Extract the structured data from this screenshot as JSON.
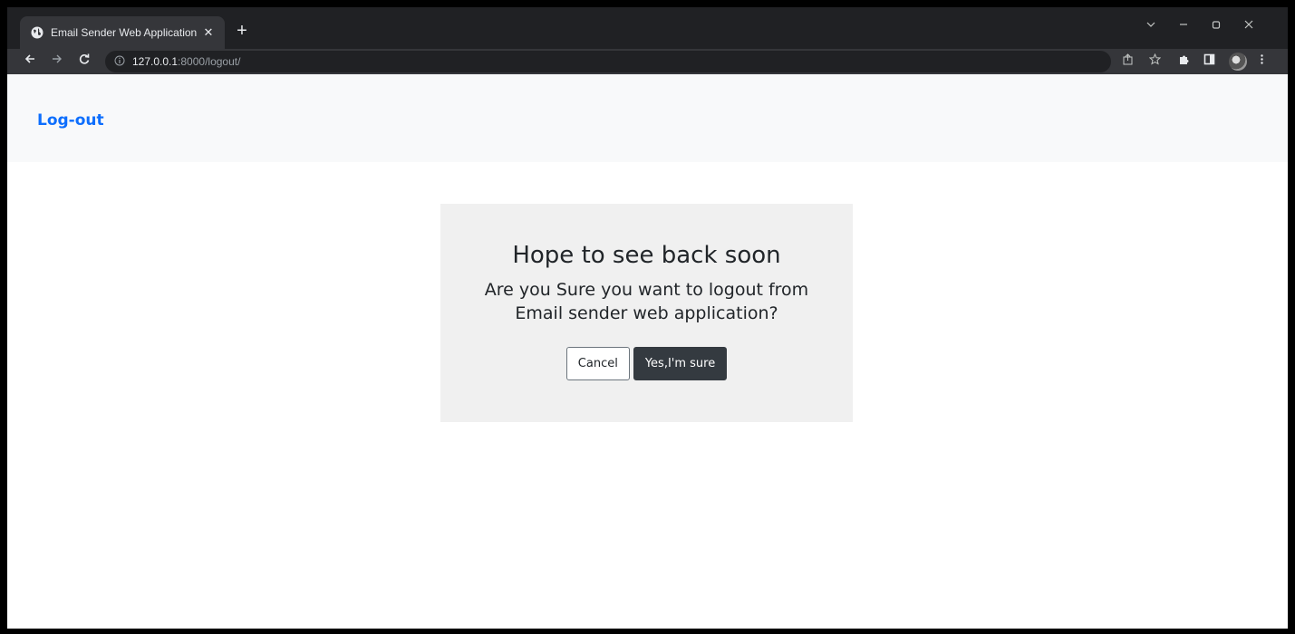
{
  "browser": {
    "tab_title": "Email Sender Web Application",
    "tab_close": "✕",
    "new_tab": "+",
    "url_host": "127.0.0.1",
    "url_path": ":8000/logout/"
  },
  "navbar": {
    "brand": "Log-out"
  },
  "dialog": {
    "heading": "Hope to see back soon",
    "question_line1": "Are you Sure you want to logout from",
    "question_line2": "Email sender web application?",
    "cancel_label": "Cancel",
    "confirm_label": "Yes,I'm sure"
  },
  "colors": {
    "brand": "#0d6efd",
    "navbar_bg": "#f8f9fa",
    "card_bg": "#f0f0f0",
    "confirm_bg": "#343a40"
  },
  "icons": {
    "tab_favicon": "globe-icon",
    "back": "back-arrow-icon",
    "forward": "forward-arrow-icon",
    "reload": "reload-icon",
    "info": "info-icon",
    "share": "share-icon",
    "bookmark": "star-icon",
    "extensions": "puzzle-icon",
    "sidepanel": "side-panel-icon",
    "menu": "kebab-menu-icon"
  }
}
